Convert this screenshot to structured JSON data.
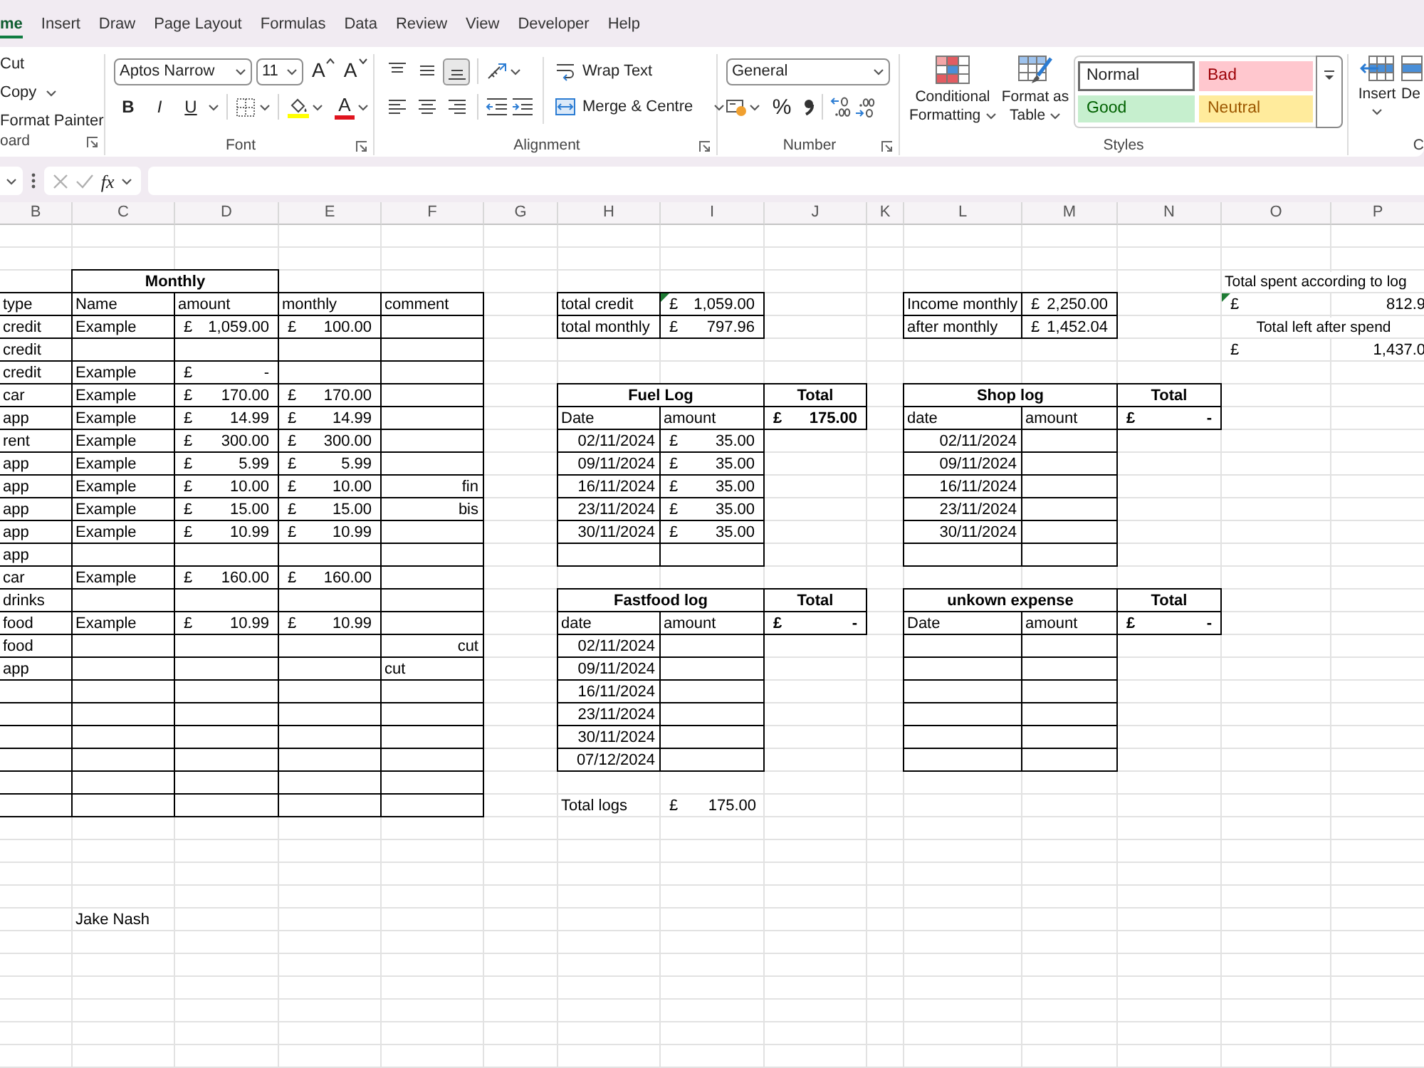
{
  "ribbon": {
    "tabs": [
      {
        "label": "me",
        "selected": true
      },
      {
        "label": "Insert",
        "selected": false
      },
      {
        "label": "Draw",
        "selected": false
      },
      {
        "label": "Page Layout",
        "selected": false
      },
      {
        "label": "Formulas",
        "selected": false
      },
      {
        "label": "Data",
        "selected": false
      },
      {
        "label": "Review",
        "selected": false
      },
      {
        "label": "View",
        "selected": false
      },
      {
        "label": "Developer",
        "selected": false
      },
      {
        "label": "Help",
        "selected": false
      }
    ],
    "clipboard": {
      "commands": [
        {
          "label": "Cut",
          "dropdown": false
        },
        {
          "label": "Copy",
          "dropdown": true
        },
        {
          "label": "Format Painter",
          "dropdown": false
        }
      ],
      "label": "oard"
    },
    "font": {
      "font_name": "Aptos Narrow",
      "font_size": "11",
      "grow": "A",
      "shrink": "A",
      "bold": "B",
      "italic": "I",
      "underline": "U",
      "font_color": "A",
      "label": "Font"
    },
    "alignment": {
      "vertical": [
        {
          "kind": "top",
          "selected": false
        },
        {
          "kind": "middle",
          "selected": false
        },
        {
          "kind": "bottom",
          "selected": true
        }
      ],
      "horizontal": [
        {
          "kind": "left",
          "selected": false
        },
        {
          "kind": "center",
          "selected": false
        },
        {
          "kind": "right",
          "selected": false
        }
      ],
      "wrap_text": "Wrap Text",
      "merge": "Merge & Centre",
      "label": "Alignment"
    },
    "number": {
      "format": "General",
      "percent": "%",
      "label": "Number"
    },
    "styles": {
      "commands": [
        {
          "kind": "conditional",
          "label": "Conditional Formatting"
        },
        {
          "kind": "table",
          "label": "Format as Table"
        }
      ],
      "gallery": [
        {
          "kind": "normal",
          "label": "Normal",
          "selected": true
        },
        {
          "kind": "bad",
          "label": "Bad",
          "selected": false
        },
        {
          "kind": "good",
          "label": "Good",
          "selected": false
        },
        {
          "kind": "neutral",
          "label": "Neutral",
          "selected": false
        }
      ],
      "label": "Styles"
    },
    "cells": {
      "commands": [
        {
          "kind": "insert",
          "label": "Insert"
        },
        {
          "kind": "delete",
          "label": "De"
        }
      ],
      "label": "C"
    }
  },
  "formula_bar": {
    "function_label": "fx"
  },
  "sheet": {
    "columns": [
      "B",
      "C",
      "D",
      "E",
      "F",
      "G",
      "H",
      "I",
      "J",
      "K",
      "L",
      "M",
      "N",
      "O",
      "P"
    ],
    "expenses": {
      "title": "Monthly",
      "header": [
        "type",
        "Name",
        "amount",
        "monthly",
        "comment"
      ],
      "rows": [
        {
          "type": "credit",
          "name": "Example",
          "amount": {
            "symbol": "£",
            "value": "1,059.00"
          },
          "monthly": {
            "symbol": "£",
            "value": "100.00"
          }
        },
        {
          "type": "credit"
        },
        {
          "type": "credit",
          "name": "Example",
          "amount": {
            "symbol": "£",
            "value": "-"
          }
        },
        {
          "type": "car",
          "name": "Example",
          "amount": {
            "symbol": "£",
            "value": "170.00"
          },
          "monthly": {
            "symbol": "£",
            "value": "170.00"
          }
        },
        {
          "type": "app",
          "name": "Example",
          "amount": {
            "symbol": "£",
            "value": "14.99"
          },
          "monthly": {
            "symbol": "£",
            "value": "14.99"
          }
        },
        {
          "type": "rent",
          "name": "Example",
          "amount": {
            "symbol": "£",
            "value": "300.00"
          },
          "monthly": {
            "symbol": "£",
            "value": "300.00"
          }
        },
        {
          "type": "app",
          "name": "Example",
          "amount": {
            "symbol": "£",
            "value": "5.99"
          },
          "monthly": {
            "symbol": "£",
            "value": "5.99"
          }
        },
        {
          "type": "app",
          "name": "Example",
          "amount": {
            "symbol": "£",
            "value": "10.00"
          },
          "monthly": {
            "symbol": "£",
            "value": "10.00"
          },
          "comment": {
            "text": "fin",
            "right_aligned": true
          }
        },
        {
          "type": "app",
          "name": "Example",
          "amount": {
            "symbol": "£",
            "value": "15.00"
          },
          "monthly": {
            "symbol": "£",
            "value": "15.00"
          },
          "comment": {
            "text": "bis",
            "right_aligned": true
          }
        },
        {
          "type": "app",
          "name": "Example",
          "amount": {
            "symbol": "£",
            "value": "10.99"
          },
          "monthly": {
            "symbol": "£",
            "value": "10.99"
          }
        },
        {
          "type": "app"
        },
        {
          "type": "car",
          "name": "Example",
          "amount": {
            "symbol": "£",
            "value": "160.00"
          },
          "monthly": {
            "symbol": "£",
            "value": "160.00"
          }
        },
        {
          "type": "drinks"
        },
        {
          "type": "food",
          "name": "Example",
          "amount": {
            "symbol": "£",
            "value": "10.99"
          },
          "monthly": {
            "symbol": "£",
            "value": "10.99"
          }
        },
        {
          "type": "food",
          "comment": {
            "text": "cut",
            "right_aligned": true
          }
        },
        {
          "type": "app",
          "comment": {
            "text": "cut",
            "right_aligned": false
          }
        }
      ]
    },
    "totals": [
      {
        "rows": [
          {
            "label": "total credit",
            "symbol": "£",
            "value": "1,059.00",
            "indicator": true
          },
          {
            "label": "total monthly",
            "symbol": "£",
            "value": "797.96",
            "indicator": false
          }
        ]
      },
      {
        "rows": [
          {
            "label": "Income monthly",
            "symbol": "£",
            "value": "2,250.00",
            "indicator": false
          },
          {
            "label": "after monthly",
            "symbol": "£",
            "value": "1,452.04",
            "indicator": false
          }
        ]
      }
    ],
    "logs": [
      {
        "title": "Fuel Log",
        "total_heading": "Total",
        "header": [
          "Date",
          "amount"
        ],
        "total": {
          "symbol": "£",
          "value": "175.00"
        },
        "entries": [
          {
            "date": "02/11/2024",
            "amount": {
              "symbol": "£",
              "value": "35.00"
            }
          },
          {
            "date": "09/11/2024",
            "amount": {
              "symbol": "£",
              "value": "35.00"
            }
          },
          {
            "date": "16/11/2024",
            "amount": {
              "symbol": "£",
              "value": "35.00"
            }
          },
          {
            "date": "23/11/2024",
            "amount": {
              "symbol": "£",
              "value": "35.00"
            }
          },
          {
            "date": "30/11/2024",
            "amount": {
              "symbol": "£",
              "value": "35.00"
            }
          }
        ]
      },
      {
        "title": "Shop log",
        "total_heading": "Total",
        "header": [
          "date",
          "amount"
        ],
        "total": {
          "symbol": "£",
          "value": "-"
        },
        "entries": [
          {
            "date": "02/11/2024"
          },
          {
            "date": "09/11/2024"
          },
          {
            "date": "16/11/2024"
          },
          {
            "date": "23/11/2024"
          },
          {
            "date": "30/11/2024"
          }
        ]
      },
      {
        "title": "Fastfood log",
        "total_heading": "Total",
        "header": [
          "date",
          "amount"
        ],
        "total": {
          "symbol": "£",
          "value": "-"
        },
        "entries": [
          {
            "date": "02/11/2024"
          },
          {
            "date": "09/11/2024"
          },
          {
            "date": "16/11/2024"
          },
          {
            "date": "23/11/2024"
          },
          {
            "date": "30/11/2024"
          },
          {
            "date": "07/12/2024"
          }
        ]
      },
      {
        "title": "unkown expense",
        "total_heading": "Total",
        "header": [
          "Date",
          "amount"
        ],
        "total": {
          "symbol": "£",
          "value": "-"
        }
      }
    ],
    "total_logs": {
      "label": "Total logs",
      "symbol": "£",
      "value": "175.00"
    },
    "spend_summary": [
      {
        "kind": "heading",
        "label": "Total spent according to log",
        "centered": false
      },
      {
        "kind": "amount",
        "symbol": "£",
        "value": "812.9",
        "indicator": true
      },
      {
        "kind": "heading",
        "label": "Total left after spend",
        "centered": true
      },
      {
        "kind": "amount",
        "symbol": "£",
        "value": "1,437.0",
        "indicator": false
      }
    ],
    "signature": "Jake Nash"
  }
}
